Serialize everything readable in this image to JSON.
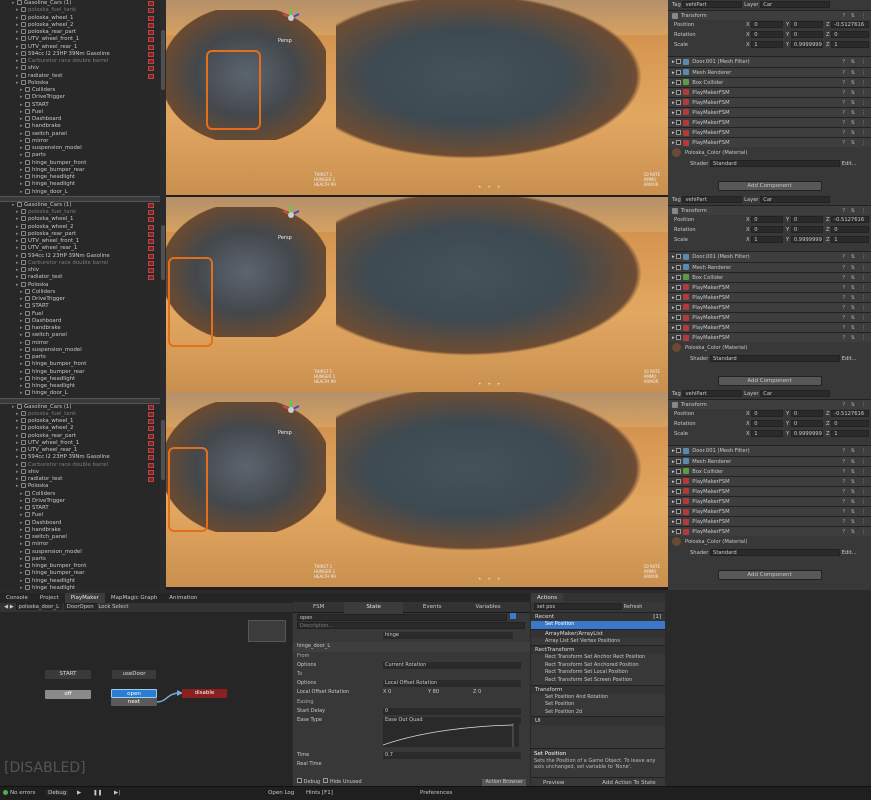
{
  "hierarchy": {
    "rows": [
      {
        "label": "Gasoline_Cars (1)",
        "dim": false
      },
      {
        "label": "poloska_fuel_tank",
        "dim": true
      },
      {
        "label": "poloska_wheel_1",
        "dim": false
      },
      {
        "label": "poloska_wheel_2",
        "dim": false
      },
      {
        "label": "poloska_rear_part",
        "dim": false
      },
      {
        "label": "UTV_wheel_front_1",
        "dim": false
      },
      {
        "label": "UTV_wheel_rear_1",
        "dim": false
      },
      {
        "label": "594cc I2 23HP 39Nm Gasoline",
        "dim": false
      },
      {
        "label": "Carburetor race double barrel",
        "dim": true
      },
      {
        "label": "shiv",
        "dim": false
      },
      {
        "label": "radiator_test",
        "dim": false
      },
      {
        "label": "Poloska",
        "dim": false
      },
      {
        "label": "Colliders",
        "dim": false
      },
      {
        "label": "DriveTrigger",
        "dim": false
      },
      {
        "label": "START",
        "dim": false
      },
      {
        "label": "Fuel",
        "dim": false
      },
      {
        "label": "Dashboard",
        "dim": false
      },
      {
        "label": "handbrake",
        "dim": false
      },
      {
        "label": "switch_panel",
        "dim": false
      },
      {
        "label": "mirror",
        "dim": false
      },
      {
        "label": "suspension_model",
        "dim": false
      },
      {
        "label": "parts",
        "dim": false
      },
      {
        "label": "hinge_bumper_front",
        "dim": false
      },
      {
        "label": "hinge_bumper_rear",
        "dim": false
      },
      {
        "label": "hinge_headlight",
        "dim": false
      },
      {
        "label": "hinge_headlight",
        "dim": false
      },
      {
        "label": "hinge_door_L",
        "dim": false
      }
    ],
    "selected": "poloska_door_L"
  },
  "viewport": {
    "stats_left": "THIRST 1\nHUNGER 1\nHEALTH 99",
    "stats_right": "10 RATE\nAMMO\nARMOR",
    "persp": "Persp",
    "dots": "• • •"
  },
  "inspector": {
    "tag_label": "Tag",
    "tag_value": "vehiPart",
    "layer_label": "Layer",
    "layer_value": "Car",
    "transform": "Transform",
    "position_label": "Position",
    "rotation_label": "Rotation",
    "scale_label": "Scale",
    "pos": {
      "x": "0",
      "y": "0",
      "z": "-0.5127616"
    },
    "rot": {
      "x": "0",
      "y": "0",
      "z": "0"
    },
    "scl": {
      "x": "1",
      "y": "0.9999999",
      "z": "1"
    },
    "components": [
      "Door.001 (Mesh Filter)",
      "Mesh Renderer",
      "Box Collider",
      "PlayMakerFSM",
      "PlayMakerFSM",
      "PlayMakerFSM",
      "PlayMakerFSM",
      "PlayMakerFSM",
      "PlayMakerFSM"
    ],
    "material": "Poloska_Color (Material)",
    "shader_label": "Shader",
    "shader_value": "Standard",
    "edit": "Edit...",
    "add_component": "Add Component"
  },
  "bottom": {
    "tabs": [
      "Console",
      "Project",
      "PlayMaker",
      "MapMagic Graph",
      "Animation"
    ],
    "toolbar": {
      "object": "poloska_door_L",
      "state": "DoorOpen",
      "lock": "Lock",
      "select": "Select"
    },
    "graph": {
      "start": "START",
      "usedoor": "useDoor",
      "off": "off",
      "open": "open",
      "next": "next",
      "disable": "disable",
      "disabled": "[DISABLED]"
    },
    "fsm_tabs": [
      "FSM",
      "State",
      "Events",
      "Variables"
    ],
    "fsm": {
      "state_name": "open",
      "description": "Description...",
      "action_title": "hinge_door_L",
      "from": "From",
      "options": "Options",
      "options_val": "Current Rotation",
      "to": "To",
      "options2_val": "Local Offset Rotation",
      "local_offset": "Local Offset Rotation",
      "x": "X 0",
      "y": "Y 80",
      "z": "Z 0",
      "easing": "Easing",
      "start_delay": "Start Delay",
      "start_delay_val": "0",
      "ease_type": "Ease Type",
      "ease_val": "Ease Out Quad",
      "time": "Time",
      "time_val": "0.7",
      "real_time": "Real Time",
      "hinge": "hinge",
      "debug": "Debug",
      "hide_unused": "Hide Unused",
      "action_browser": "Action Browser"
    },
    "actions": {
      "title": "Actions",
      "search": "set pos",
      "refresh": "Refresh",
      "recent": "Recent",
      "recent_count": "[1]",
      "items_recent": [
        "Set Position"
      ],
      "sec_array": "ArrayMaker/ArrayList",
      "items_array": [
        "Array List Set Vertex Positions"
      ],
      "sec_rect": "RectTransform",
      "items_rect": [
        "Rect Transform Set Anchor Rect Position",
        "Rect Transform Set Anchored Position",
        "Rect Transform Set Local Position",
        "Rect Transform Set Screen Position"
      ],
      "sec_transform": "Transform",
      "items_transform": [
        "Set Position And Rotation",
        "Set Position",
        "Set Position 2d"
      ],
      "sec_ui": "UI",
      "help_title": "Set Position",
      "help_text": "Sets the Position of a Game Object. To leave any axis unchanged, set variable to 'None'.",
      "preview": "Preview",
      "add_action": "Add Action To State"
    },
    "status": {
      "errors": "No errors",
      "debug": "Debug",
      "open_log": "Open Log",
      "hints": "Hints [F1]",
      "preferences": "Preferences"
    }
  }
}
